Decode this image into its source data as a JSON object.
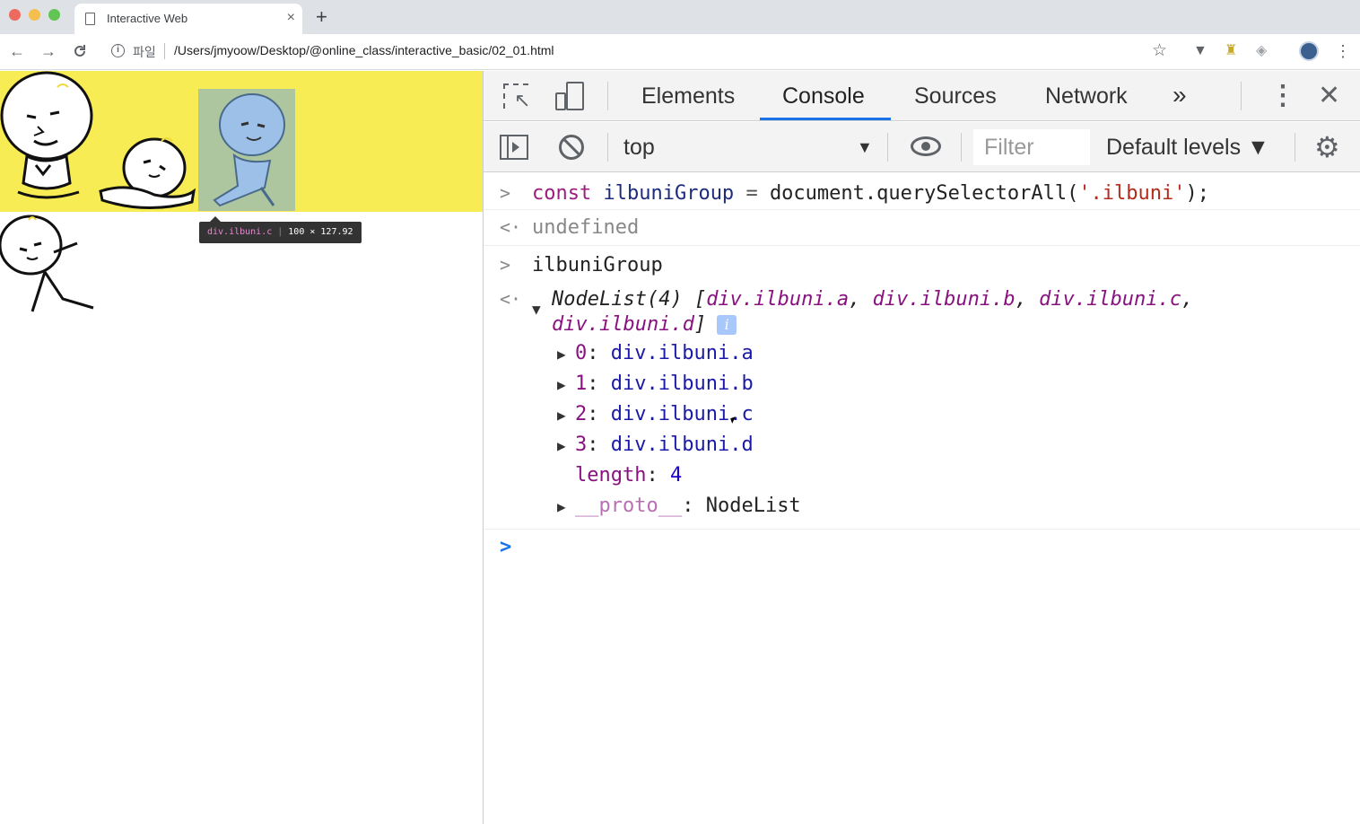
{
  "browser": {
    "tab_title": "Interactive Web",
    "tab_close": "×",
    "new_tab": "+",
    "back": "←",
    "forward": "→",
    "reload": "C",
    "info_icon": "i",
    "file_label": "파일",
    "url": "/Users/jmyoow/Desktop/@online_class/interactive_basic/02_01.html",
    "star": "☆",
    "menu": "⋮"
  },
  "page": {
    "band_color": "#f8ec54",
    "tooltip": {
      "tag": "div.ilbuni.c",
      "size": "100 × 127.92"
    }
  },
  "devtools": {
    "tabs": [
      "Elements",
      "Console",
      "Sources",
      "Network"
    ],
    "active_tab": "Console",
    "more_tabs": "»",
    "kebab": "⋮",
    "close": "✕",
    "context": "top",
    "context_arrow": "▼",
    "filter_placeholder": "Filter",
    "levels": "Default levels ▼",
    "gear": "⚙"
  },
  "console": {
    "input1": {
      "kw": "const",
      "var": "ilbuniGroup",
      "op": "=",
      "call": "document.querySelectorAll(",
      "str": "'.ilbuni'",
      "end": ");"
    },
    "output1": "undefined",
    "input2": "ilbuniGroup",
    "nodelist": {
      "head": "NodeList(4) [",
      "a": "div.ilbuni.a",
      "b": "div.ilbuni.b",
      "c": "div.ilbuni.c",
      "d": "div.ilbuni.d",
      "close": "]",
      "info": "i"
    },
    "entries": [
      {
        "key": "0",
        "val": "div.ilbuni.a"
      },
      {
        "key": "1",
        "val": "div.ilbuni.b"
      },
      {
        "key": "2",
        "val": "div.ilbuni.c"
      },
      {
        "key": "3",
        "val": "div.ilbuni.d"
      }
    ],
    "length_key": "length",
    "length_val": "4",
    "proto_key": "__proto__",
    "proto_val": "NodeList",
    "prompt": ">"
  },
  "icons": {
    "page": "page-icon",
    "inspect": "inspect-element-icon",
    "device": "device-toolbar-icon",
    "eye": "eye-icon",
    "gear": "gear-icon"
  }
}
